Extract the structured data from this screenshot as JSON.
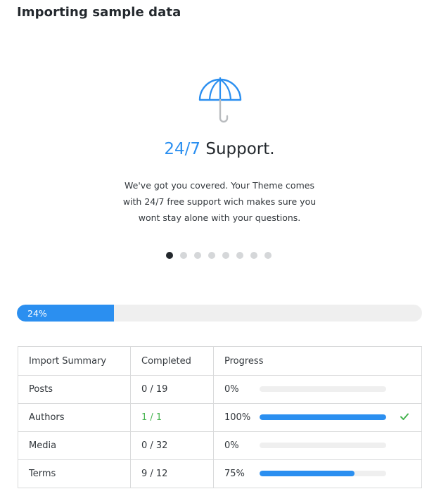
{
  "page": {
    "title": "Importing sample data"
  },
  "slide": {
    "icon": "umbrella-icon",
    "headline_accent": "24/7",
    "headline_rest": " Support.",
    "description": "We've got you covered. Your Theme comes with 24/7 free support wich makes sure you wont stay alone with your questions.",
    "dots_total": 8,
    "active_dot": 0
  },
  "overall_progress": {
    "label": "24%",
    "value": 0.24
  },
  "summary": {
    "headers": {
      "name": "Import Summary",
      "completed": "Completed",
      "progress": "Progress"
    },
    "rows": [
      {
        "name": "Posts",
        "completed": "0 / 19",
        "progress_label": "0%",
        "progress": 0.0,
        "done": false
      },
      {
        "name": "Authors",
        "completed": "1 / 1",
        "progress_label": "100%",
        "progress": 1.0,
        "done": true
      },
      {
        "name": "Media",
        "completed": "0 / 32",
        "progress_label": "0%",
        "progress": 0.0,
        "done": false
      },
      {
        "name": "Terms",
        "completed": "9 / 12",
        "progress_label": "75%",
        "progress": 0.75,
        "done": false
      }
    ]
  },
  "colors": {
    "accent": "#2b8ff0",
    "success": "#46b450",
    "track": "#efefef"
  }
}
